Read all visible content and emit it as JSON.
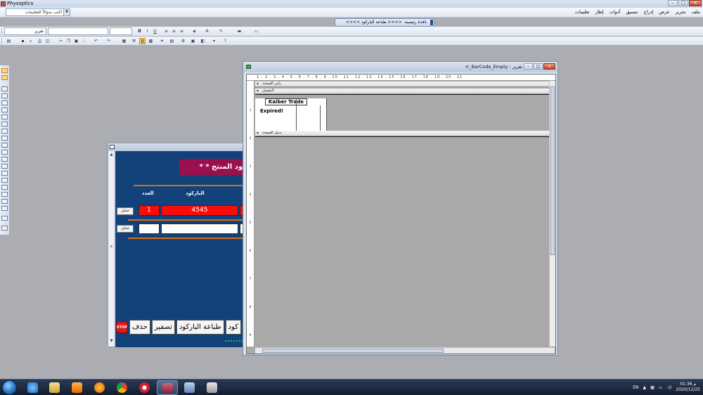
{
  "app": {
    "title": "Physoptics",
    "help_box_placeholder": "اكتب سؤالاً للتعليمات"
  },
  "menu": [
    "ملف",
    "تحرير",
    "عرض",
    "إدراج",
    "تنسيق",
    "أدوات",
    "إطار",
    "تعليمات"
  ],
  "toolbar": {
    "font_combo": "تقرير",
    "nav_home": "نافذة رئيسية",
    "nav_barcode": "<<<< طباعة الباركود >>>>"
  },
  "form": {
    "banner_title": "كود المنتج * *",
    "col_count": "العدد",
    "col_barcode": "الباركود",
    "delete_label": "حذف",
    "rows": [
      {
        "count": "1",
        "barcode": "4545"
      },
      {
        "count": "",
        "barcode": ""
      }
    ],
    "buttons": {
      "stop": "STOP",
      "delete": "حذف",
      "reset": "تصفير",
      "print_barcode": "طباعة الباركود",
      "code": "كود"
    }
  },
  "report": {
    "caption": "تقرير : rr_BarCode_Empty",
    "ruler_marks": "1 . 2 . 3 . 4 . 5 . 6 . 7 . 8 . 9 . 10 . 11 . 12 . 13 . 14 . 15 . 16 . 17 . 18 . 19 . 20 . 21",
    "section_header": "رأس الصفحة",
    "section_detail": "التفصيل",
    "section_footer": "تذييل الصفحة",
    "company": "Kaiber Trade",
    "expired": "Expired!"
  },
  "taskbar": {
    "lang": "EN",
    "time": "01:36 م",
    "date": "2020/12/25"
  },
  "colors": {
    "form_blue": "#13417a",
    "banner": "#9b0f4e",
    "red_cell": "#ff0a0a",
    "orange_line": "#d86f1b"
  }
}
